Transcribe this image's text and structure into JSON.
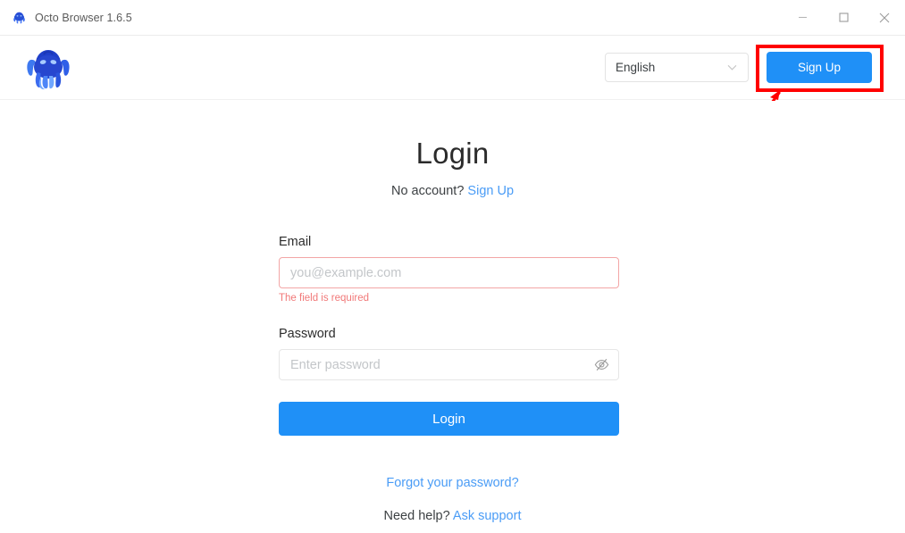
{
  "titlebar": {
    "app_icon": "octopus-icon",
    "title": "Octo Browser 1.6.5",
    "minimize_label": "–",
    "maximize_label": "☐",
    "close_label": "×"
  },
  "header": {
    "logo": "octo-browser-logo",
    "language": {
      "selected": "English",
      "chevron": "chevron-down-icon"
    },
    "signup_label": "Sign Up"
  },
  "annotation": {
    "highlight_color": "#ff0000",
    "target": "signup-button"
  },
  "main": {
    "title": "Login",
    "subline_prefix": "No account?",
    "subline_link": "Sign Up",
    "email": {
      "label": "Email",
      "placeholder": "you@example.com",
      "value": "",
      "error": "The field is required",
      "error_color": "#f17878"
    },
    "password": {
      "label": "Password",
      "placeholder": "Enter password",
      "value": "",
      "toggle_icon": "eye-slash-icon"
    },
    "login_label": "Login",
    "forgot_label": "Forgot your password?",
    "support_prefix": "Need help?",
    "support_link": "Ask support"
  },
  "colors": {
    "accent": "#1f90f7",
    "link": "#4a9cf6",
    "error": "#f17878",
    "error_border": "#f3a6a6",
    "annotation": "#ff0000"
  }
}
